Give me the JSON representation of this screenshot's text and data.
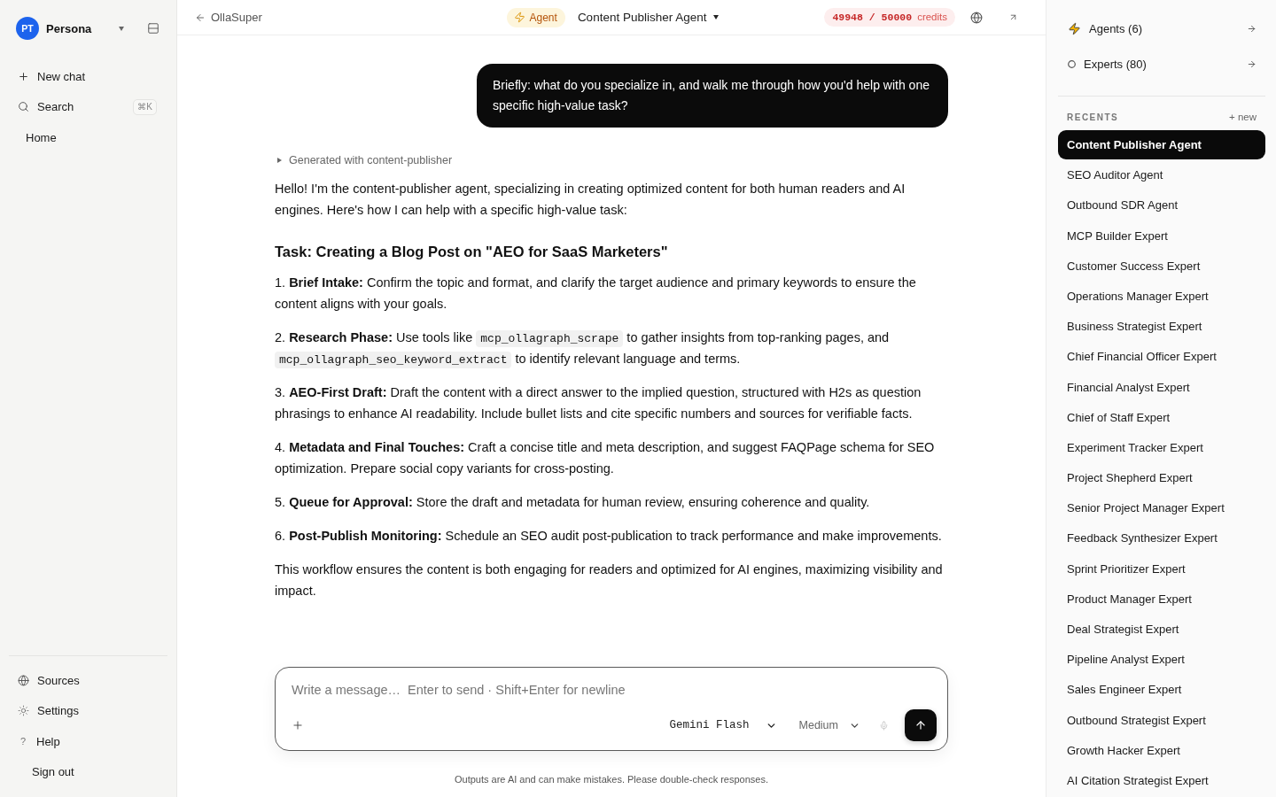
{
  "sidebar": {
    "profile": {
      "initials": "PT",
      "name": "Persona"
    },
    "new_chat": {
      "label": "New chat"
    },
    "search": {
      "label": "Search",
      "shortcut": "⌘K"
    },
    "home": {
      "label": "Home"
    },
    "sources": {
      "label": "Sources"
    },
    "settings": {
      "label": "Settings"
    },
    "help": {
      "glyph": "?",
      "label": "Help"
    },
    "sign_out": {
      "label": "Sign out"
    }
  },
  "top_bar": {
    "back_label": "OllaSuper",
    "mode_badge": "Agent",
    "agent_selector": "Content Publisher Agent",
    "credits": {
      "count": "49948 / 50000",
      "unit": "credits"
    }
  },
  "messages": [
    {
      "kind": "user",
      "text": "Briefly: what do you specialize in, and walk me through how you'd help with one specific high-value task?"
    },
    {
      "kind": "assistant",
      "source": "Generated with content-publisher",
      "expanded": false,
      "blocks": [
        {
          "kind": "paragraph",
          "text": "Hello! I'm the content-publisher agent, specializing in creating optimized content for both human readers and AI engines. Here's how I can help with a specific high-value task:"
        },
        {
          "kind": "heading",
          "text": "Task: Creating a Blog Post on \"AEO for SaaS Marketers\""
        },
        {
          "kind": "paragraph",
          "text": "1. **Brief Intake:** Confirm the topic and format, and clarify the target audience and primary keywords to ensure the content aligns with your goals."
        },
        {
          "kind": "paragraph",
          "segments": [
            {
              "kind": "text",
              "text": "2. **Research Phase:** Use tools like "
            },
            {
              "kind": "code",
              "text": "mcp_ollagraph_scrape"
            },
            {
              "kind": "text",
              "text": " to gather insights from top-ranking pages, and "
            },
            {
              "kind": "code",
              "text": "mcp_ollagraph_seo_keyword_extract"
            },
            {
              "kind": "text",
              "text": " to identify relevant language and terms."
            }
          ]
        },
        {
          "kind": "paragraph",
          "text": "3. **AEO-First Draft:** Draft the content with a direct answer to the implied question, structured with H2s as question phrasings to enhance AI readability. Include bullet lists and cite specific numbers and sources for verifiable facts."
        },
        {
          "kind": "paragraph",
          "text": "4. **Metadata and Final Touches:** Craft a concise title and meta description, and suggest FAQPage schema for SEO optimization. Prepare social copy variants for cross-posting."
        },
        {
          "kind": "paragraph",
          "text": "5. **Queue for Approval:** Store the draft and metadata for human review, ensuring coherence and quality."
        },
        {
          "kind": "paragraph",
          "text": "6. **Post-Publish Monitoring:** Schedule an SEO audit post-publication to track performance and make improvements."
        },
        {
          "kind": "paragraph",
          "text": "This workflow ensures the content is both engaging for readers and optimized for AI engines, maximizing visibility and impact."
        }
      ]
    }
  ],
  "composer": {
    "placeholder": "Write a message…  Enter to send · Shift+Enter for newline",
    "model": "Gemini Flash",
    "effort": "Medium"
  },
  "disclaimer": "Outputs are AI and can make mistakes. Please double-check responses.",
  "right_panel": {
    "agents": "Agents (6)",
    "experts": "Experts (80)",
    "recents": {
      "title": "RECENTS",
      "new_label": "+ new",
      "items": [
        {
          "label": "Content Publisher Agent",
          "selected": true
        },
        {
          "label": "SEO Auditor Agent",
          "selected": false
        },
        {
          "label": "Outbound SDR Agent",
          "selected": false
        },
        {
          "label": "MCP Builder Expert",
          "selected": false
        },
        {
          "label": "Customer Success Expert",
          "selected": false
        },
        {
          "label": "Operations Manager Expert",
          "selected": false
        },
        {
          "label": "Business Strategist Expert",
          "selected": false
        },
        {
          "label": "Chief Financial Officer Expert",
          "selected": false
        },
        {
          "label": "Financial Analyst Expert",
          "selected": false
        },
        {
          "label": "Chief of Staff Expert",
          "selected": false
        },
        {
          "label": "Experiment Tracker Expert",
          "selected": false
        },
        {
          "label": "Project Shepherd Expert",
          "selected": false
        },
        {
          "label": "Senior Project Manager Expert",
          "selected": false
        },
        {
          "label": "Feedback Synthesizer Expert",
          "selected": false
        },
        {
          "label": "Sprint Prioritizer Expert",
          "selected": false
        },
        {
          "label": "Product Manager Expert",
          "selected": false
        },
        {
          "label": "Deal Strategist Expert",
          "selected": false
        },
        {
          "label": "Pipeline Analyst Expert",
          "selected": false
        },
        {
          "label": "Sales Engineer Expert",
          "selected": false
        },
        {
          "label": "Outbound Strategist Expert",
          "selected": false
        },
        {
          "label": "Growth Hacker Expert",
          "selected": false
        },
        {
          "label": "AI Citation Strategist Expert",
          "selected": false
        }
      ]
    }
  }
}
